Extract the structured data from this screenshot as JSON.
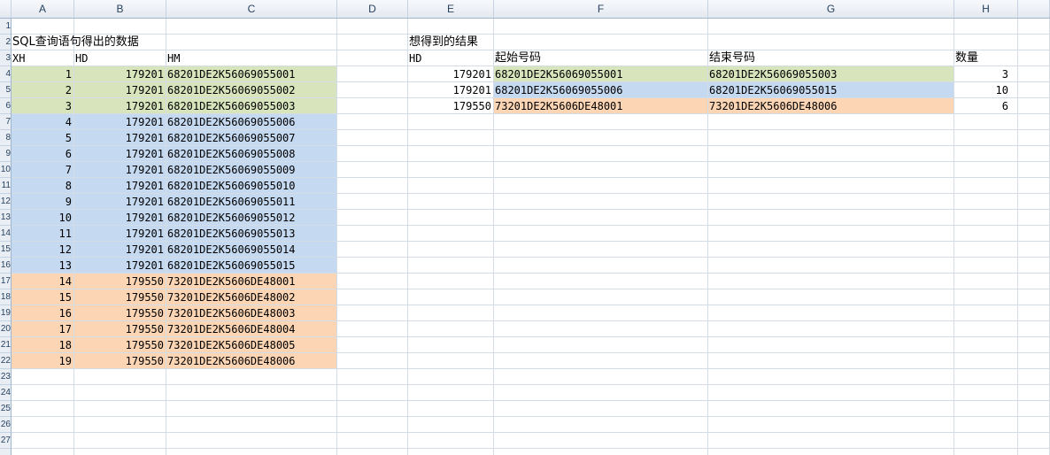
{
  "columns": [
    "A",
    "B",
    "C",
    "D",
    "E",
    "F",
    "G",
    "H"
  ],
  "row_numbers": [
    "1",
    "2",
    "3",
    "4",
    "5",
    "6",
    "7",
    "8",
    "9",
    "10",
    "11",
    "12",
    "13",
    "14",
    "15",
    "16",
    "17",
    "18",
    "19",
    "20",
    "21",
    "22",
    "23",
    "24",
    "25",
    "26",
    "27"
  ],
  "left_table": {
    "title": "SQL查询语句得出的数据",
    "headers": {
      "xh": "XH",
      "hd": "HD",
      "hm": "HM"
    },
    "rows": [
      {
        "xh": "1",
        "hd": "179201",
        "hm": "68201DE2K56069055001",
        "group": "green"
      },
      {
        "xh": "2",
        "hd": "179201",
        "hm": "68201DE2K56069055002",
        "group": "green"
      },
      {
        "xh": "3",
        "hd": "179201",
        "hm": "68201DE2K56069055003",
        "group": "green"
      },
      {
        "xh": "4",
        "hd": "179201",
        "hm": "68201DE2K56069055006",
        "group": "blue"
      },
      {
        "xh": "5",
        "hd": "179201",
        "hm": "68201DE2K56069055007",
        "group": "blue"
      },
      {
        "xh": "6",
        "hd": "179201",
        "hm": "68201DE2K56069055008",
        "group": "blue"
      },
      {
        "xh": "7",
        "hd": "179201",
        "hm": "68201DE2K56069055009",
        "group": "blue"
      },
      {
        "xh": "8",
        "hd": "179201",
        "hm": "68201DE2K56069055010",
        "group": "blue"
      },
      {
        "xh": "9",
        "hd": "179201",
        "hm": "68201DE2K56069055011",
        "group": "blue"
      },
      {
        "xh": "10",
        "hd": "179201",
        "hm": "68201DE2K56069055012",
        "group": "blue"
      },
      {
        "xh": "11",
        "hd": "179201",
        "hm": "68201DE2K56069055013",
        "group": "blue"
      },
      {
        "xh": "12",
        "hd": "179201",
        "hm": "68201DE2K56069055014",
        "group": "blue"
      },
      {
        "xh": "13",
        "hd": "179201",
        "hm": "68201DE2K56069055015",
        "group": "blue"
      },
      {
        "xh": "14",
        "hd": "179550",
        "hm": "73201DE2K5606DE48001",
        "group": "orange"
      },
      {
        "xh": "15",
        "hd": "179550",
        "hm": "73201DE2K5606DE48002",
        "group": "orange"
      },
      {
        "xh": "16",
        "hd": "179550",
        "hm": "73201DE2K5606DE48003",
        "group": "orange"
      },
      {
        "xh": "17",
        "hd": "179550",
        "hm": "73201DE2K5606DE48004",
        "group": "orange"
      },
      {
        "xh": "18",
        "hd": "179550",
        "hm": "73201DE2K5606DE48005",
        "group": "orange"
      },
      {
        "xh": "19",
        "hd": "179550",
        "hm": "73201DE2K5606DE48006",
        "group": "orange"
      }
    ]
  },
  "right_table": {
    "title": "想得到的结果",
    "headers": {
      "hd": "HD",
      "start": "起始号码",
      "end": "结束号码",
      "count": "数量"
    },
    "rows": [
      {
        "hd": "179201",
        "start": "68201DE2K56069055001",
        "end": "68201DE2K56069055003",
        "count": "3",
        "group": "green"
      },
      {
        "hd": "179201",
        "start": "68201DE2K56069055006",
        "end": "68201DE2K56069055015",
        "count": "10",
        "group": "blue"
      },
      {
        "hd": "179550",
        "start": "73201DE2K5606DE48001",
        "end": "73201DE2K5606DE48006",
        "count": "6",
        "group": "orange"
      }
    ]
  },
  "colors": {
    "green": "#d8e4bc",
    "blue": "#c5d9f1",
    "orange": "#fcd5b4",
    "gridline": "#d4dce6",
    "header_bg": "#e4e9f0"
  }
}
